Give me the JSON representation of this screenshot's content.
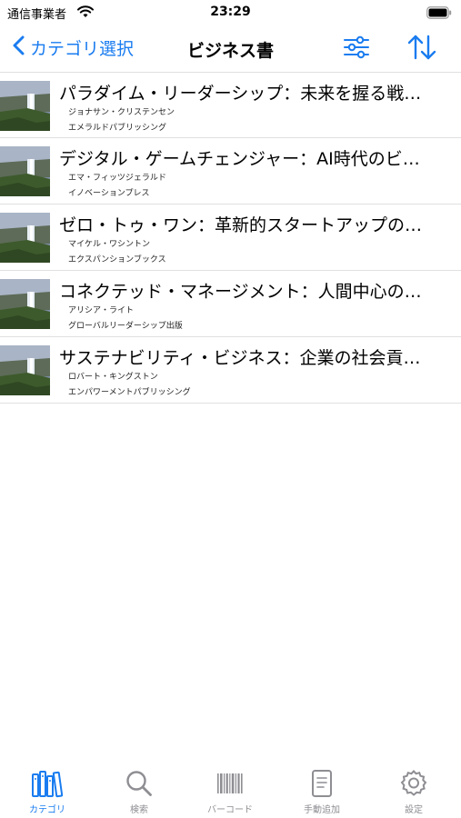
{
  "status": {
    "carrier": "通信事業者",
    "time": "23:29"
  },
  "nav": {
    "back_label": "カテゴリ選択",
    "title": "ビジネス書"
  },
  "colors": {
    "accent": "#1a7cf0",
    "inactive": "#8e8e93",
    "separator": "#e0e0e0"
  },
  "books": [
    {
      "title": "パラダイム・リーダーシップ：未来を握る戦…",
      "author": "ジョナサン・クリステンセン",
      "publisher": "エメラルドパブリッシング"
    },
    {
      "title": "デジタル・ゲームチェンジャー：AI時代のビ…",
      "author": "エマ・フィッツジェラルド",
      "publisher": "イノベーションプレス"
    },
    {
      "title": "ゼロ・トゥ・ワン：革新的スタートアップの…",
      "author": "マイケル・ワシントン",
      "publisher": "エクスパンションブックス"
    },
    {
      "title": "コネクテッド・マネージメント：人間中心の…",
      "author": "アリシア・ライト",
      "publisher": "グローバルリーダーシップ出版"
    },
    {
      "title": "サステナビリティ・ビジネス：企業の社会貢…",
      "author": "ロバート・キングストン",
      "publisher": "エンパワーメントパブリッシング"
    }
  ],
  "tabs": [
    {
      "label": "カテゴリ",
      "icon": "books-icon",
      "active": true
    },
    {
      "label": "検索",
      "icon": "search-icon",
      "active": false
    },
    {
      "label": "バーコード",
      "icon": "barcode-icon",
      "active": false
    },
    {
      "label": "手動追加",
      "icon": "document-icon",
      "active": false
    },
    {
      "label": "設定",
      "icon": "gear-icon",
      "active": false
    }
  ]
}
